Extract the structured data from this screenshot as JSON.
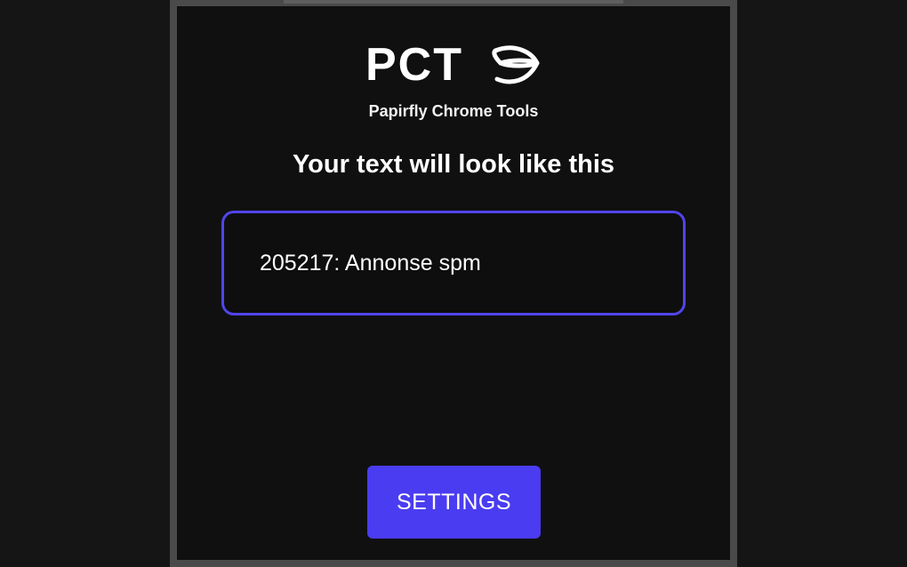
{
  "brand": {
    "name": "PCT",
    "subtitle": "Papirfly Chrome Tools",
    "logo_icon": "papirfly-leaf-icon"
  },
  "preview": {
    "heading": "Your text will look like this",
    "sample_text": "205217: Annonse spm"
  },
  "actions": {
    "settings_label": "SETTINGS"
  },
  "colors": {
    "accent": "#4a3cf0",
    "border_accent": "#5145ea",
    "background": "#101010",
    "frame": "#4a4a4a",
    "outer_background": "#151515"
  }
}
